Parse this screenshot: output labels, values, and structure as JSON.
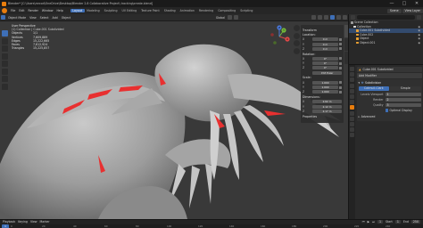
{
  "window": {
    "title": "Blender* [C:\\Users\\mrcod\\OneDrive\\Desktop\\Blender 2.8 Collaborative Project\\ tracking\\create.blend]",
    "buttons": [
      "—",
      "□",
      "✕"
    ]
  },
  "menu": {
    "items": [
      "File",
      "Edit",
      "Render",
      "Window",
      "Help"
    ],
    "workspaces": [
      "Layout",
      "Modeling",
      "Sculpting",
      "UV Editing",
      "Texture Paint",
      "Shading",
      "Animation",
      "Rendering",
      "Compositing",
      "Scripting"
    ],
    "active_workspace": "Layout",
    "scene": "Scene",
    "view_layer": "View Layer"
  },
  "viewport_header": {
    "mode": "Object Mode",
    "items": [
      "View",
      "Select",
      "Add",
      "Object"
    ],
    "transform": "Global"
  },
  "viewport": {
    "view_name": "User Perspective",
    "collection": "(1) Collection | Cube.001 Subdivided",
    "stats": [
      {
        "label": "Objects",
        "value": "1/1"
      },
      {
        "label": "Vertices",
        "value": "7,609,889"
      },
      {
        "label": "Edges",
        "value": "15,222,665"
      },
      {
        "label": "Faces",
        "value": "7,612,924"
      },
      {
        "label": "Triangles",
        "value": "15,225,857"
      }
    ],
    "gizmo_axes": [
      "X",
      "Y",
      "Z"
    ]
  },
  "npanel": {
    "transform_title": "Transform",
    "location_title": "Location:",
    "location": [
      {
        "axis": "X",
        "value": "0 m"
      },
      {
        "axis": "Y",
        "value": "0 m"
      },
      {
        "axis": "Z",
        "value": "0 m"
      }
    ],
    "rotation_title": "Rotation:",
    "rotation": [
      {
        "axis": "X",
        "value": "0°"
      },
      {
        "axis": "Y",
        "value": "0°"
      },
      {
        "axis": "Z",
        "value": "0°"
      }
    ],
    "rotation_mode": "XYZ Euler",
    "scale_title": "Scale:",
    "scale": [
      {
        "axis": "X",
        "value": "1.000"
      },
      {
        "axis": "Y",
        "value": "1.000"
      },
      {
        "axis": "Z",
        "value": "1.000"
      }
    ],
    "dimensions_title": "Dimensions:",
    "dimensions": [
      {
        "axis": "X",
        "value": "2.62 m"
      },
      {
        "axis": "Y",
        "value": "2.12 m"
      },
      {
        "axis": "Z",
        "value": "2.17 m"
      }
    ],
    "properties_title": "Properties",
    "tabs": [
      "Item",
      "Tool",
      "View"
    ]
  },
  "outliner": {
    "rows": [
      {
        "name": "Scene Collection",
        "color": "#9a9a9a",
        "selected": false
      },
      {
        "name": "Collection",
        "color": "#dcdcdc",
        "selected": false
      },
      {
        "name": "Cube.001 Subdivided",
        "color": "#e8a032",
        "selected": true
      },
      {
        "name": "Cube.002",
        "color": "#e8a032",
        "selected": false
      },
      {
        "name": "Object",
        "color": "#e8a032",
        "selected": false
      },
      {
        "name": "Object.001",
        "color": "#e8a032",
        "selected": false
      }
    ]
  },
  "properties": {
    "object_name": "Cube.001 Subdivided",
    "add_modifier": "Add Modifier",
    "modifier_name": "Subdivision",
    "subdivision_options": [
      "Catmull-Clark",
      "Simple"
    ],
    "fields": [
      {
        "label": "Levels Viewport",
        "value": "1"
      },
      {
        "label": "Render",
        "value": "2"
      },
      {
        "label": "Quality",
        "value": "3"
      }
    ],
    "checkbox": "Optimal Display",
    "advanced": "Advanced"
  },
  "timeline": {
    "controls": [
      "Playback",
      "Keying",
      "View",
      "Marker"
    ],
    "current_frame": "1",
    "start_label": "Start",
    "start": "1",
    "end_label": "End",
    "end": "250",
    "ticks": [
      "0",
      "20",
      "40",
      "60",
      "80",
      "100",
      "120",
      "140",
      "160",
      "180",
      "200",
      "220",
      "240"
    ]
  },
  "colors": {
    "accent": "#3e6fb7",
    "blender_orange": "#e87d0d",
    "selection_red": "#e83030",
    "background": "#393939"
  }
}
